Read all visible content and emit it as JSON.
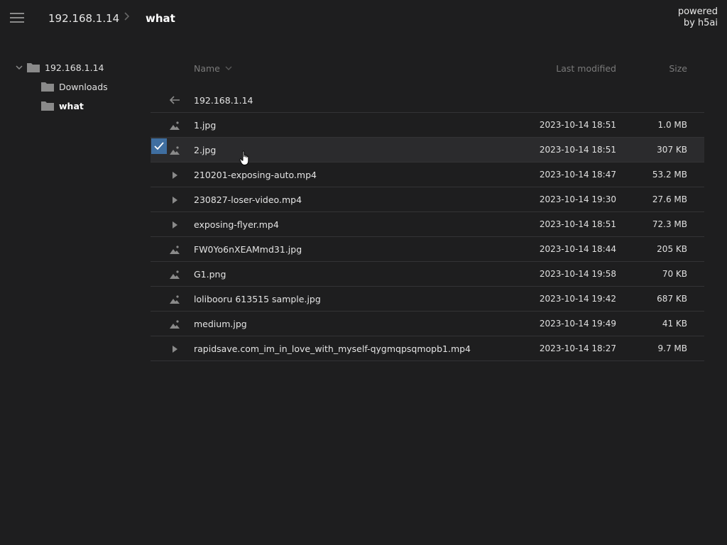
{
  "topbar": {
    "menu_icon": "hamburger-menu-icon",
    "breadcrumb": {
      "host": "192.168.1.14",
      "separator": ">",
      "current": "what"
    },
    "powered_line1": "powered",
    "powered_line2": "by h5ai"
  },
  "sidebar": {
    "root": {
      "label": "192.168.1.14",
      "icon": "folder-icon",
      "expanded": true
    },
    "children": [
      {
        "label": "Downloads",
        "icon": "folder-icon",
        "current": false
      },
      {
        "label": "what",
        "icon": "folder-icon",
        "current": true
      }
    ]
  },
  "listing": {
    "columns": {
      "name": "Name",
      "modified": "Last modified",
      "size": "Size"
    },
    "parent": {
      "label": "192.168.1.14",
      "icon": "arrow-left-icon"
    },
    "files": [
      {
        "name": "1.jpg",
        "modified": "2023-10-14 18:51",
        "size": "1.0 MB",
        "type": "image",
        "selected": false
      },
      {
        "name": "2.jpg",
        "modified": "2023-10-14 18:51",
        "size": "307 KB",
        "type": "image",
        "selected": true
      },
      {
        "name": "210201-exposing-auto.mp4",
        "modified": "2023-10-14 18:47",
        "size": "53.2 MB",
        "type": "video",
        "selected": false
      },
      {
        "name": "230827-loser-video.mp4",
        "modified": "2023-10-14 19:30",
        "size": "27.6 MB",
        "type": "video",
        "selected": false
      },
      {
        "name": "exposing-flyer.mp4",
        "modified": "2023-10-14 18:51",
        "size": "72.3 MB",
        "type": "video",
        "selected": false
      },
      {
        "name": "FW0Yo6nXEAMmd31.jpg",
        "modified": "2023-10-14 18:44",
        "size": "205 KB",
        "type": "image",
        "selected": false
      },
      {
        "name": "G1.png",
        "modified": "2023-10-14 19:58",
        "size": "70 KB",
        "type": "image",
        "selected": false
      },
      {
        "name": "lolibooru 613515 sample.jpg",
        "modified": "2023-10-14 19:42",
        "size": "687 KB",
        "type": "image",
        "selected": false
      },
      {
        "name": "medium.jpg",
        "modified": "2023-10-14 19:49",
        "size": "41 KB",
        "type": "image",
        "selected": false
      },
      {
        "name": "rapidsave.com_im_in_love_with_myself-qygmqpsqmopb1.mp4",
        "modified": "2023-10-14 18:27",
        "size": "9.7 MB",
        "type": "video",
        "selected": false
      }
    ]
  },
  "colors": {
    "background": "#1e1e1f",
    "selected_row": "#2b2b2d",
    "checkbox": "#3f6ea0",
    "icon": "#8a8a8a"
  }
}
